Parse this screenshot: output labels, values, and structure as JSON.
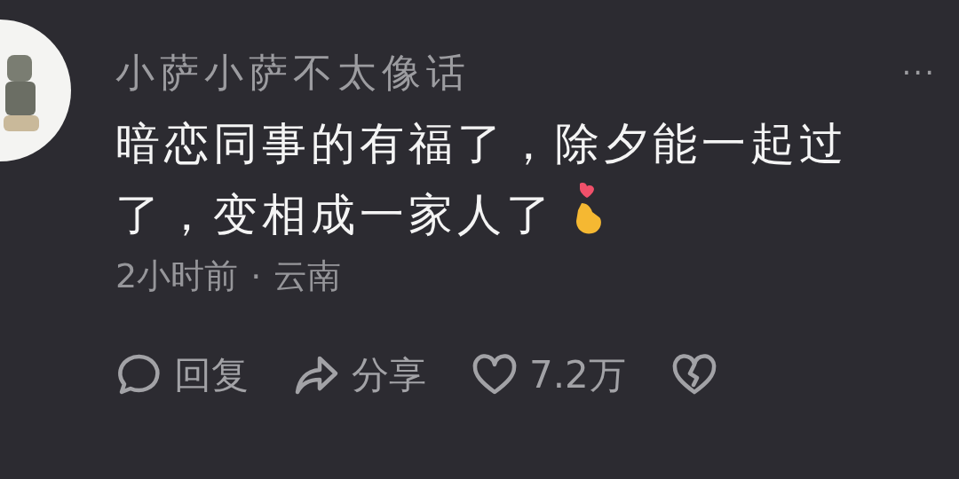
{
  "user": {
    "name": "小萨小萨不太像话"
  },
  "more": {
    "label": "···"
  },
  "comment": {
    "text": "暗恋同事的有福了，除夕能一起过了，变相成一家人了"
  },
  "meta": {
    "time": "2小时前",
    "separator": "·",
    "location": "云南"
  },
  "actions": [
    {
      "kind": "reply",
      "label": "回复"
    },
    {
      "kind": "share",
      "label": "分享"
    },
    {
      "kind": "like",
      "label": "7.2万"
    },
    {
      "kind": "dislike"
    }
  ]
}
